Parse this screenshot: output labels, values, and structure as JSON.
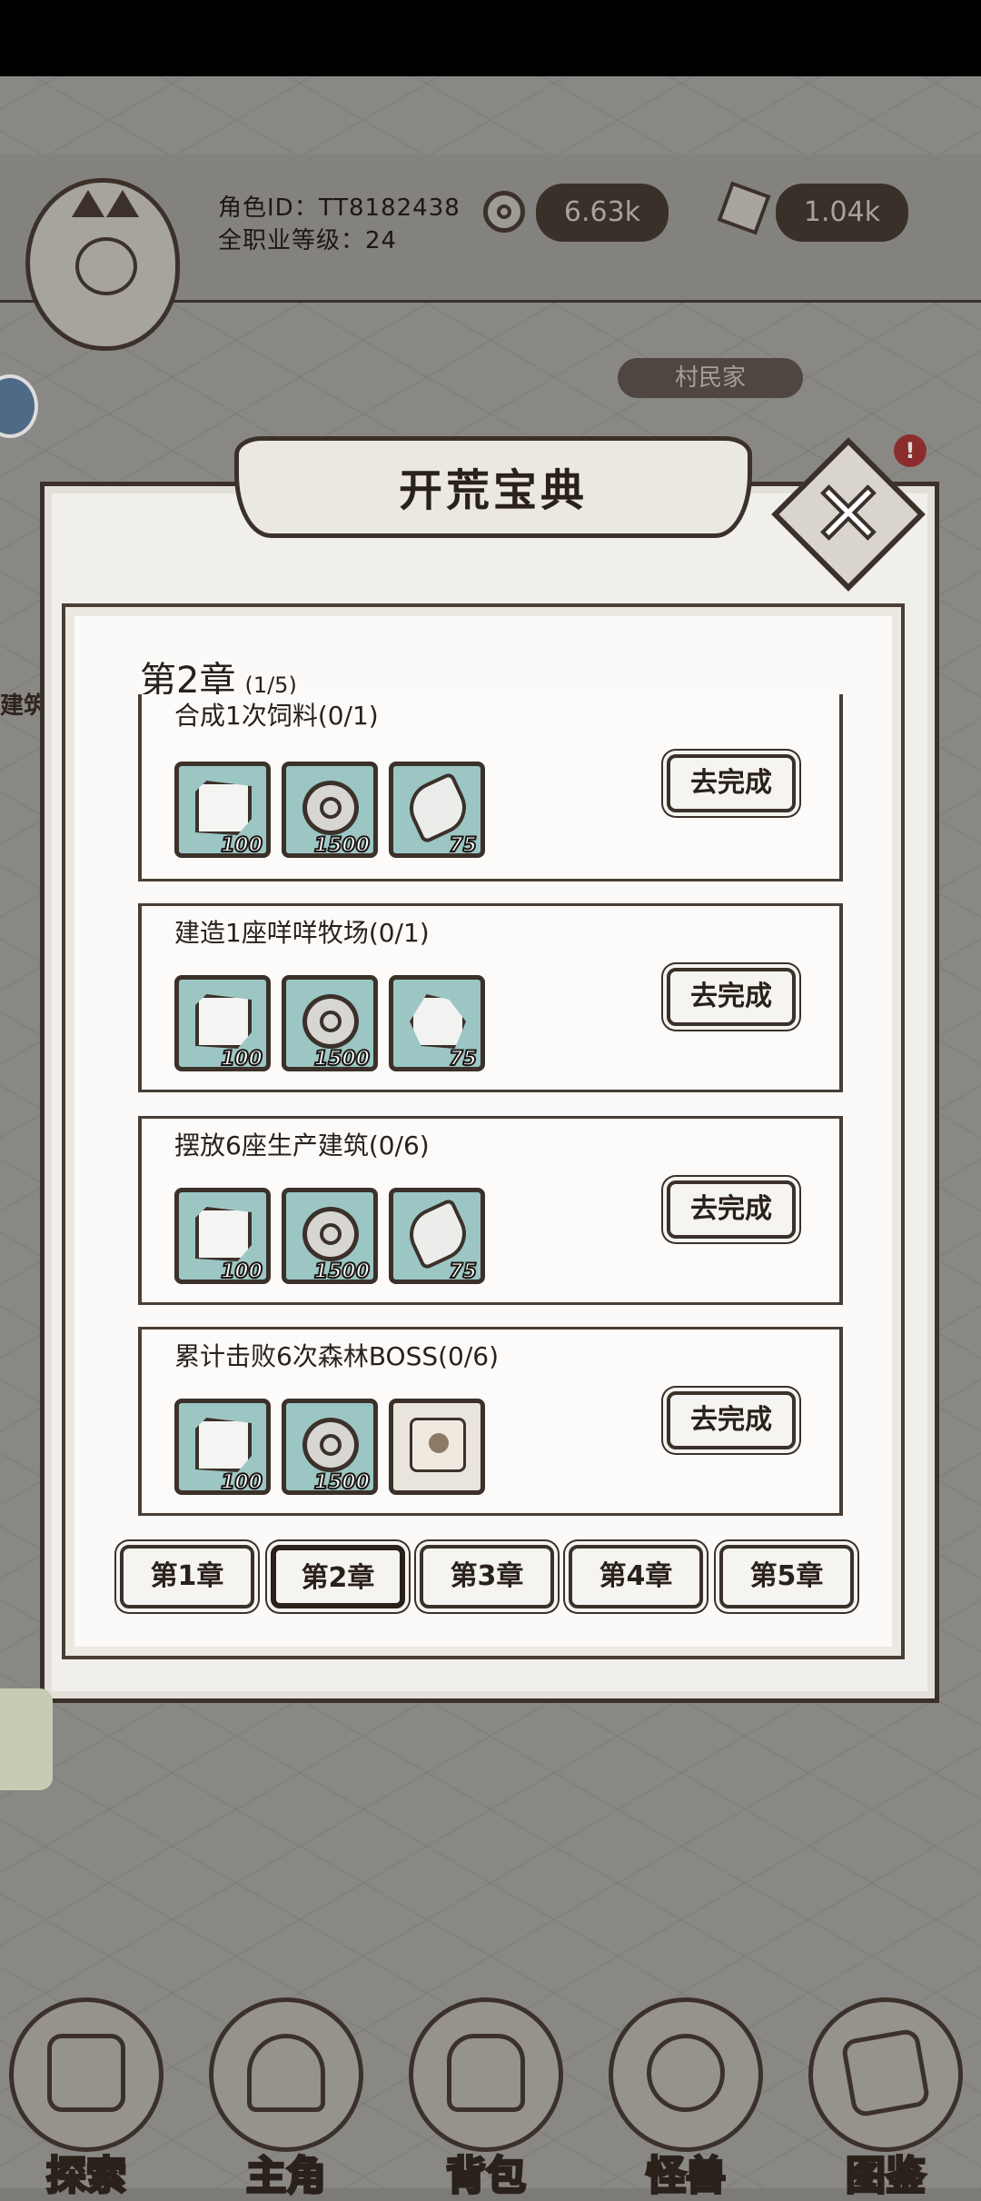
{
  "header": {
    "player_id": "角色ID：TT8182438",
    "player_level": "全职业等级：24",
    "coin_amount": "6.63k",
    "stone_amount": "1.04k",
    "village_label": "村民家",
    "side_label": "建筑",
    "alert_mark": "!"
  },
  "dialog": {
    "title": "开荒宝典",
    "close_symbol": "✕",
    "chapter_title": "第2章",
    "chapter_progress": "(1/5)",
    "tasks": [
      {
        "name": "合成1次饲料(0/1)",
        "button": "去完成",
        "rewards": [
          {
            "icon": "gem",
            "count": "100"
          },
          {
            "icon": "coin",
            "count": "1500"
          },
          {
            "icon": "log",
            "count": "75"
          }
        ]
      },
      {
        "name": "建造1座咩咩牧场(0/1)",
        "button": "去完成",
        "rewards": [
          {
            "icon": "gem",
            "count": "100"
          },
          {
            "icon": "coin",
            "count": "1500"
          },
          {
            "icon": "ore",
            "count": "75"
          }
        ]
      },
      {
        "name": "摆放6座生产建筑(0/6)",
        "button": "去完成",
        "rewards": [
          {
            "icon": "gem",
            "count": "100"
          },
          {
            "icon": "coin",
            "count": "1500"
          },
          {
            "icon": "log",
            "count": "75"
          }
        ]
      },
      {
        "name": "累计击败6次森林BOSS(0/6)",
        "button": "去完成",
        "rewards": [
          {
            "icon": "gem",
            "count": "100"
          },
          {
            "icon": "coin",
            "count": "1500"
          },
          {
            "icon": "boss-portrait",
            "count": ""
          }
        ]
      }
    ],
    "chapter_tabs": [
      "第1章",
      "第2章",
      "第3章",
      "第4章",
      "第5章"
    ],
    "active_tab": 1
  },
  "nav": {
    "items": [
      "探索",
      "主角",
      "背包",
      "怪兽",
      "图鉴"
    ]
  },
  "colors": {
    "ink": "#3b312a",
    "paper": "#fbfaf8",
    "reward_bg": "#9bc6c4",
    "overlay_bg": "#8a8884",
    "pill_bg": "#3a302a"
  }
}
